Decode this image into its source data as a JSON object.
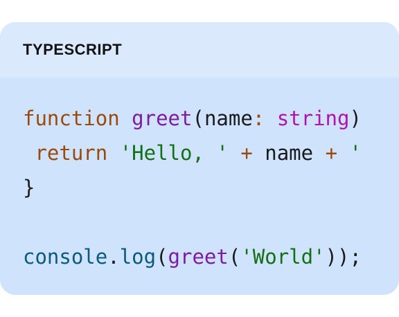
{
  "header": {
    "language": "TYPESCRIPT"
  },
  "code": {
    "line1": {
      "kw": "function",
      "sp1": " ",
      "fn": "greet",
      "p1": "(",
      "arg": "name",
      "colon": ":",
      "sp2": " ",
      "type": "string",
      "p2": ")"
    },
    "line2": {
      "indent": " ",
      "kw": "return",
      "sp1": " ",
      "str1": "'Hello, '",
      "sp2": " ",
      "op1": "+",
      "sp3": " ",
      "var": "name",
      "sp4": " ",
      "op2": "+",
      "sp5": " ",
      "str2": "'"
    },
    "line3": {
      "brace": "}"
    },
    "line4": {},
    "line5": {
      "obj": "console",
      "dot": ".",
      "method": "log",
      "p1": "(",
      "fn": "greet",
      "p2": "(",
      "str": "'World'",
      "p3": "));"
    }
  }
}
